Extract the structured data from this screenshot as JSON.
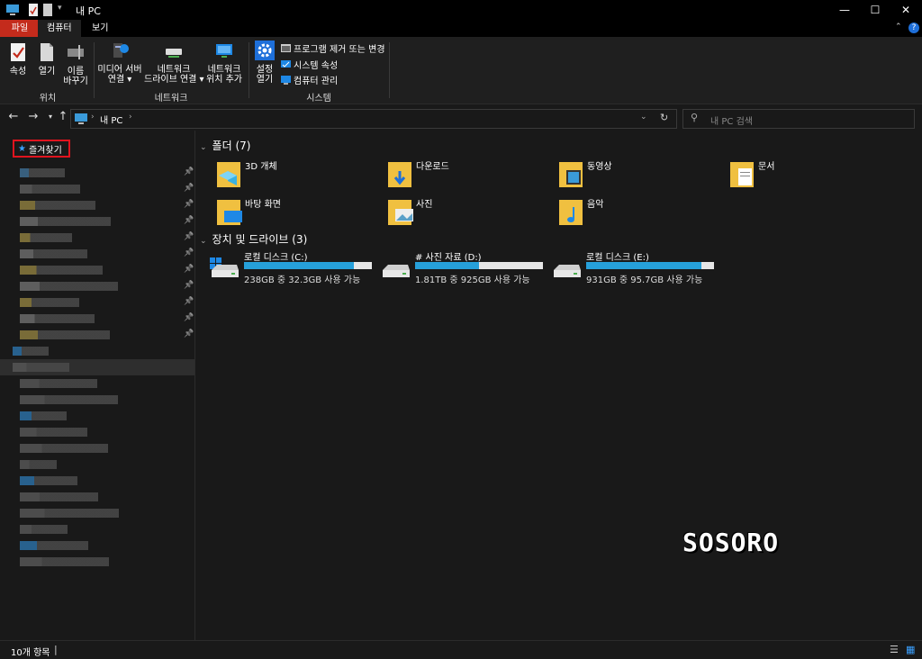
{
  "window": {
    "title": "내 PC"
  },
  "tabs": {
    "file": "파일",
    "computer": "컴퓨터",
    "view": "보기"
  },
  "ribbon": {
    "location": {
      "properties": "속성",
      "open": "열기",
      "rename": "이름\n바꾸기",
      "group": "위치"
    },
    "network": {
      "media": "미디어 서버\n연결 ▾",
      "map_drive": "네트워크\n드라이브 연결 ▾",
      "add_location": "네트워크\n위치 추가",
      "group": "네트워크"
    },
    "system": {
      "settings": "설정\n열기",
      "uninstall": "프로그램 제거 또는 변경",
      "sys_props": "시스템 속성",
      "manage": "컴퓨터 관리",
      "group": "시스템"
    }
  },
  "address": {
    "path": "내 PC",
    "search_placeholder": "내 PC 검색"
  },
  "nav": {
    "favorites": "즐겨찾기"
  },
  "folders": {
    "header": "폴더 (7)",
    "items": [
      "3D 개체",
      "다운로드",
      "동영상",
      "문서",
      "바탕 화면",
      "사진",
      "음악"
    ]
  },
  "drives": {
    "header": "장치 및 드라이브 (3)",
    "items": [
      {
        "name": "로컬 디스크 (C:)",
        "info": "238GB 중 32.3GB 사용 가능",
        "used": 0.86
      },
      {
        "name": "# 사진 자료 (D:)",
        "info": "1.81TB 중 925GB 사용 가능",
        "used": 0.5
      },
      {
        "name": "로컬 디스크 (E:)",
        "info": "931GB 중 95.7GB 사용 가능",
        "used": 0.9
      }
    ]
  },
  "status": {
    "count": "10개 항목"
  },
  "watermark": "SOSORO",
  "colors": {
    "accent": "#26a0da",
    "file_tab": "#c42b1c",
    "highlight": "#e0141e"
  }
}
